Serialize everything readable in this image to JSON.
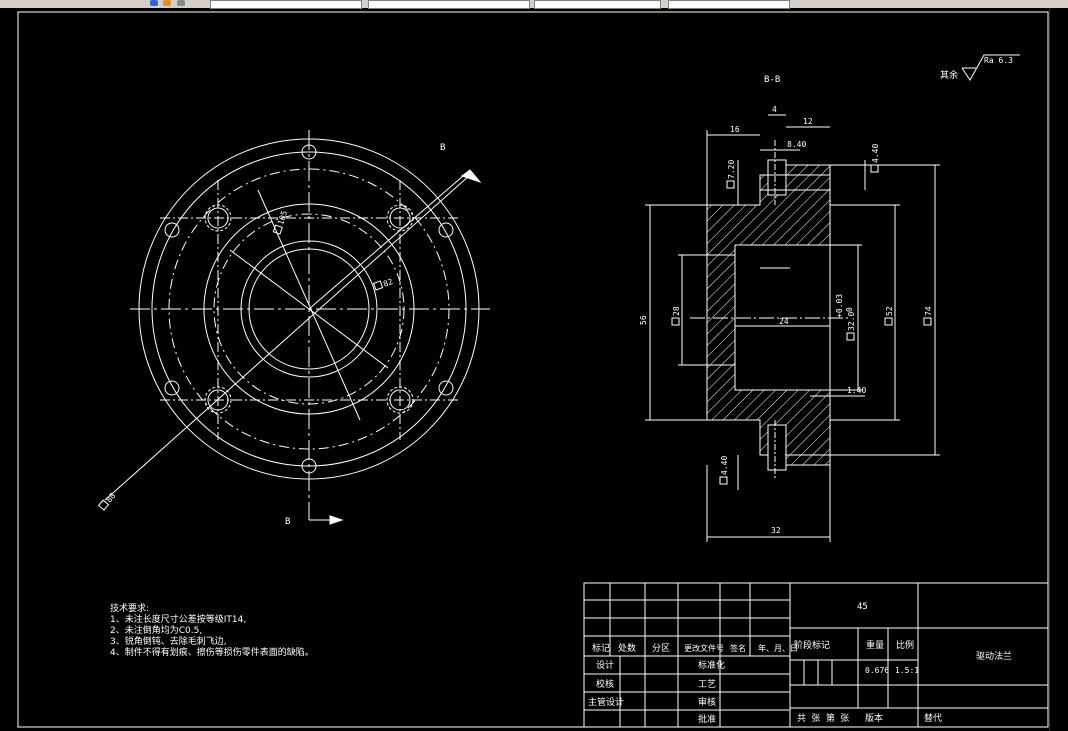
{
  "section_label": "B-B",
  "cut_label_top": "B",
  "cut_label_bottom": "B",
  "roughness": {
    "prefix": "其余",
    "value": "Ra 6.3"
  },
  "left_view_dims": {
    "d105": "105",
    "d82": "82",
    "d88": "88"
  },
  "section_dims": {
    "w4": "4",
    "w12": "12",
    "w16": "16",
    "w8_40": "8.40",
    "w7_20": "7.20",
    "w4_40_top": "4.40",
    "d56": "56",
    "d28": "28",
    "tol": "+0.03",
    "tol0": "0",
    "d32_0": "32.0",
    "d24": "24",
    "d52": "52",
    "d74": "74",
    "w1_40": "1.40",
    "w4_40_bottom": "4.40",
    "w32": "32"
  },
  "tech_requirements": {
    "title": "技术要求:",
    "items": [
      "1、未注长度尺寸公差按等级IT14,",
      "2、未注倒角均为C0.5,",
      "3、锐角倒钝、去除毛刺飞边,",
      "4、制件不得有划痕、擦伤等损伤零件表面的缺陷。"
    ]
  },
  "title_block": {
    "material": "45",
    "part_name": "驱动法兰",
    "weight": "0.676",
    "scale": "1.5:1",
    "headers": [
      "标记",
      "处数",
      "分区",
      "更改文件号",
      "签名",
      "年、月、日"
    ],
    "stage_mark": "阶段标记",
    "weight_label": "重量",
    "scale_label": "比例",
    "design": "设计",
    "standardize": "标准化",
    "check": "校核",
    "process": "工艺",
    "chief": "主管设计",
    "review": "审核",
    "approve": "批准",
    "sheet_info": "共 张 第 张",
    "version": "版本",
    "replace": "替代"
  }
}
